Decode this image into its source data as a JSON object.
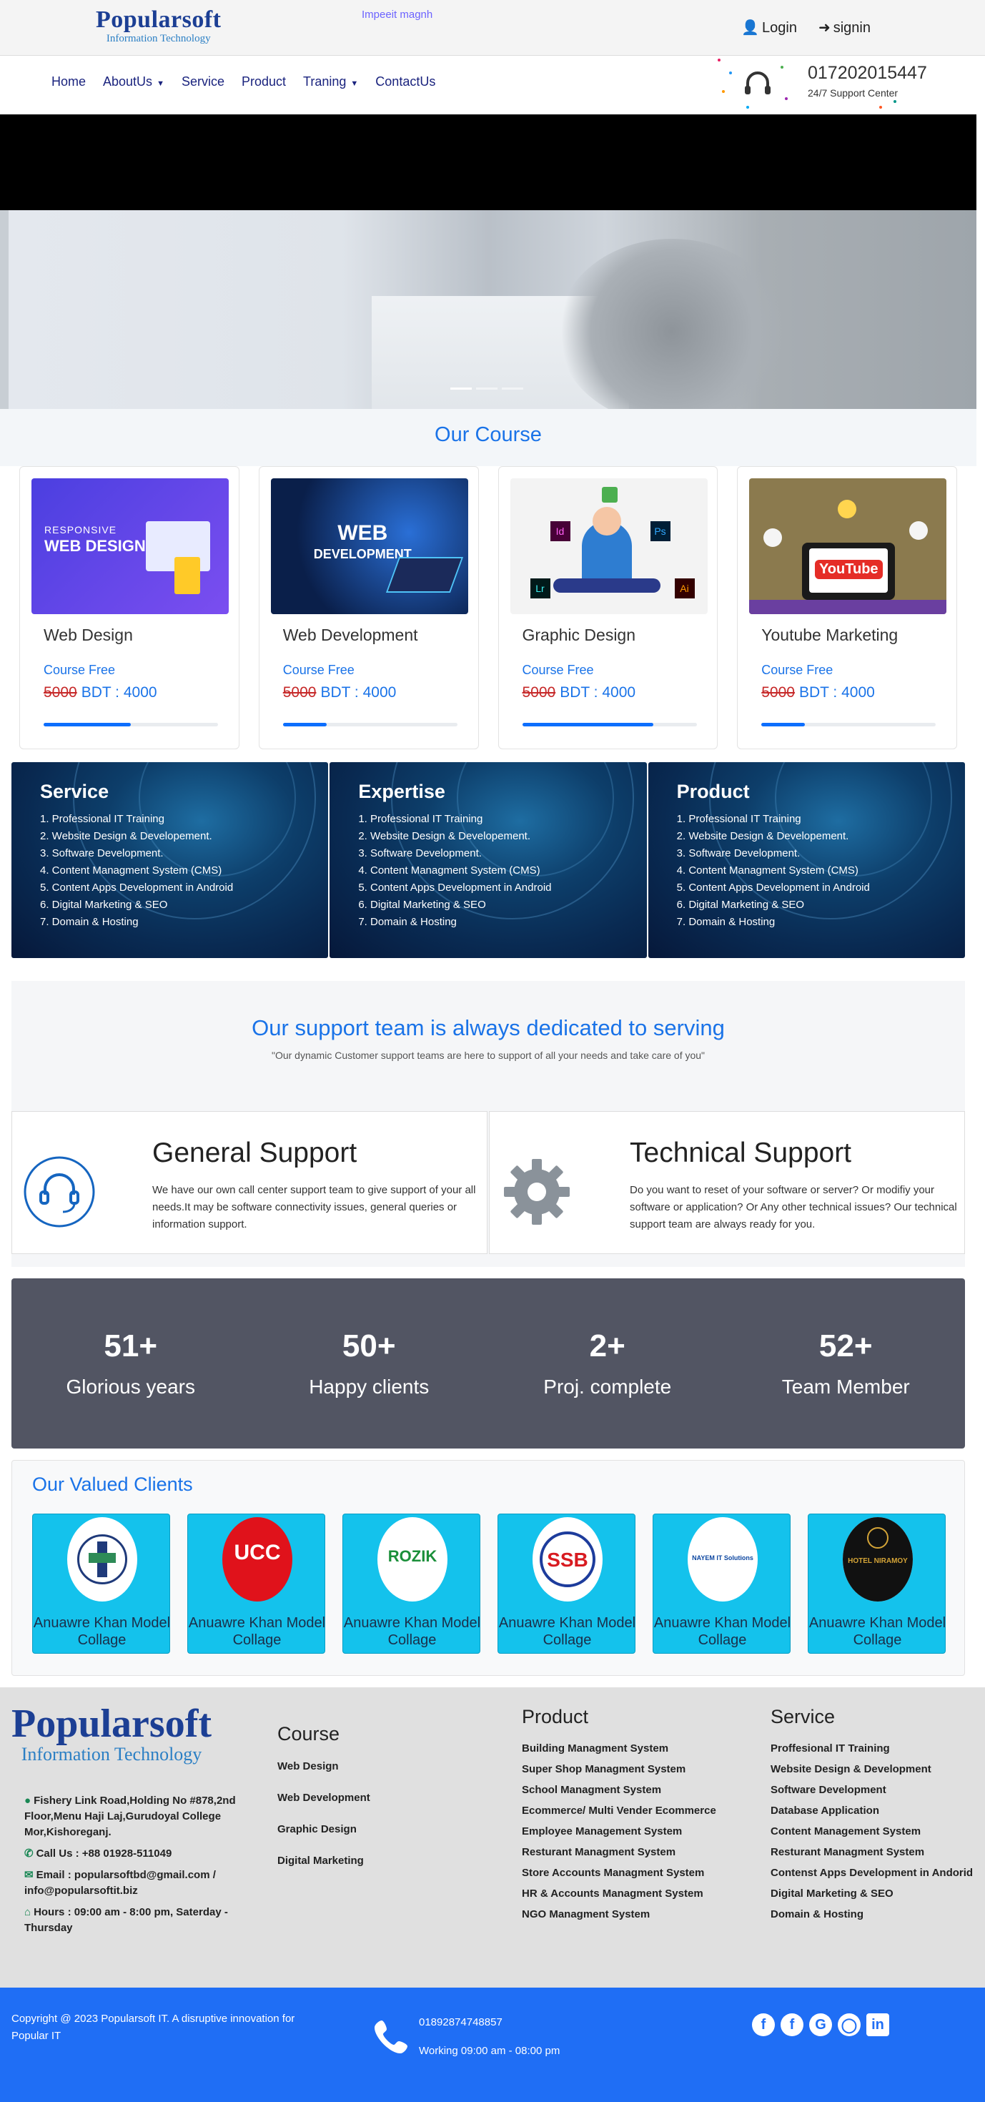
{
  "brand": {
    "name": "Popularsoft",
    "tagline": "Information Technology"
  },
  "marquee": "Impeeit magnh",
  "auth": {
    "login": "Login",
    "signin": "signin"
  },
  "nav": {
    "items": [
      {
        "label": "Home",
        "dropdown": false
      },
      {
        "label": "AboutUs",
        "dropdown": true
      },
      {
        "label": "Service",
        "dropdown": false
      },
      {
        "label": "Product",
        "dropdown": false
      },
      {
        "label": "Traning",
        "dropdown": true
      },
      {
        "label": "ContactUs",
        "dropdown": false
      }
    ]
  },
  "support_center": {
    "phone": "01720201​5447",
    "label": "24/7 Support Center"
  },
  "hero": {
    "slides": 3,
    "active": 0
  },
  "courses": {
    "title": "Our Course",
    "items": [
      {
        "name": "Web Design",
        "fee": "Course Free",
        "old_price": "5000",
        "price": "BDT : 4000",
        "progress": 0.5,
        "thumb": "responsive-web-design",
        "thumb_text": "RESPONSIVE WEB DESIGN"
      },
      {
        "name": "Web Development",
        "fee": "Course Free",
        "old_price": "5000",
        "price": "BDT : 4000",
        "progress": 0.25,
        "thumb": "web-development",
        "thumb_text": "WEB DEVELOPMENT"
      },
      {
        "name": "Graphic Design",
        "fee": "Course Free",
        "old_price": "5000",
        "price": "BDT : 4000",
        "progress": 0.75,
        "thumb": "graphic-design",
        "thumb_text": ""
      },
      {
        "name": "Youtube Marketing",
        "fee": "Course Free",
        "old_price": "5000",
        "price": "BDT : 4000",
        "progress": 0.25,
        "thumb": "youtube-marketing",
        "thumb_text": "YouTube"
      }
    ]
  },
  "panels": [
    {
      "title": "Service",
      "items": [
        "1. Professional IT Training",
        "2. Website Design & Developement.",
        "3. Software Development.",
        "4. Content Managment System (CMS)",
        "5. Content Apps Development in Android",
        "6. Digital Marketing & SEO",
        "7. Domain & Hosting"
      ]
    },
    {
      "title": "Expertise",
      "items": [
        "1. Professional IT Training",
        "2. Website Design & Developement.",
        "3. Software Development.",
        "4. Content Managment System (CMS)",
        "5. Content Apps Development in Android",
        "6. Digital Marketing & SEO",
        "7. Domain & Hosting"
      ]
    },
    {
      "title": "Product",
      "items": [
        "1. Professional IT Training",
        "2. Website Design & Developement.",
        "3. Software Development.",
        "4. Content Managment System (CMS)",
        "5. Content Apps Development in Android",
        "6. Digital Marketing & SEO",
        "7. Domain & Hosting"
      ]
    }
  ],
  "support": {
    "title": "Our support team is always dedicated to serving",
    "subtitle": "\"Our dynamic Customer support teams are here to support of all your needs and take care of you\"",
    "cards": [
      {
        "title": "General Support",
        "icon": "headset-icon",
        "text": "We have our own call center support team to give support of your all needs.It may be software connectivity issues, general queries or information support."
      },
      {
        "title": "Technical Support",
        "icon": "gear-icon",
        "text": "Do you want to reset of your software or server? Or modifiy your software or application? Or Any other technical issues? Our technical support team are always ready for you."
      }
    ]
  },
  "stats": [
    {
      "num": "51+",
      "label": "Glorious years"
    },
    {
      "num": "50+",
      "label": "Happy clients"
    },
    {
      "num": "2+",
      "label": "Proj. complete"
    },
    {
      "num": "52+",
      "label": "Team Member"
    }
  ],
  "clients": {
    "title": "Our Valued Clients",
    "items": [
      {
        "name": "Anuawre Khan Model Collage",
        "logo": "medical-seal",
        "logo_text": ""
      },
      {
        "name": "Anuawre Khan Model Collage",
        "logo": "ucc-logo",
        "logo_text": "UCC"
      },
      {
        "name": "Anuawre Khan Model Collage",
        "logo": "rozik-logo",
        "logo_text": "ROZIK"
      },
      {
        "name": "Anuawre Khan Model Collage",
        "logo": "ssb-logo",
        "logo_text": "SSB"
      },
      {
        "name": "Anuawre Khan Model Collage",
        "logo": "nayem-it-logo",
        "logo_text": "NAYEM IT Solutions"
      },
      {
        "name": "Anuawre Khan Model Collage",
        "logo": "hotel-niramoy-logo",
        "logo_text": "HOTEL NIRAMOY"
      }
    ]
  },
  "footer": {
    "address": "Fishery Link Road,Holding No #878,2nd Floor,Menu Haji Laj,Gurudoyal College Mor,Kishoreganj.",
    "call": "Call Us : +88 01928-511049",
    "email": "Email : popularsoftbd@gmail.com / info@popularsoftit.biz",
    "hours": "Hours : 09:00 am - 8:00 pm, Saterday - Thursday",
    "course": {
      "title": "Course",
      "items": [
        "Web Design",
        "Web Development",
        "Graphic Design",
        "Digital Marketing"
      ]
    },
    "product": {
      "title": "Product",
      "items": [
        "Building Managment System",
        "Super Shop Managment System",
        "School Managment System",
        "Ecommerce/ Multi Vender Ecommerce",
        "Employee Management System",
        "Resturant Managment System",
        "Store Accounts Managment System",
        "HR & Accounts Managment System",
        "NGO Managment System"
      ]
    },
    "service": {
      "title": "Service",
      "items": [
        "Proffesional IT Training",
        "Website Design & Development",
        "Software Development",
        "Database Application",
        "Content Management System",
        "Resturant Managment System",
        "Contenst Apps Development in Andorid",
        "Digital Marketing & SEO",
        "Domain & Hosting"
      ]
    }
  },
  "bottom": {
    "copyright": "Copyright @ 2023 Popularsoft IT. A disruptive innovation for Popular IT",
    "phone": "01892874748857",
    "hours": "Working 09:00 am - 08:00 pm",
    "social": [
      "facebook-icon",
      "facebook-icon",
      "google-icon",
      "chrome-icon",
      "linkedin-icon"
    ]
  },
  "colors": {
    "accent": "#1a73e8",
    "brand": "#1c3f94",
    "footer_bottom": "#1f6ef5",
    "stats_bg": "#525563",
    "client_bg": "#14c2ec"
  }
}
